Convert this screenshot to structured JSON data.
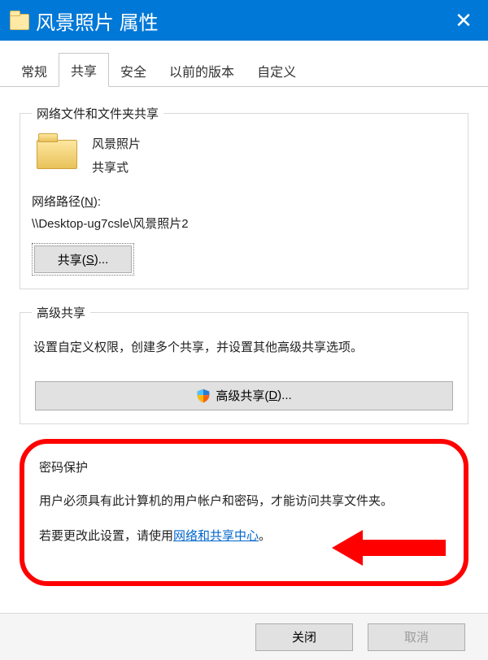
{
  "title": "风景照片 属性",
  "tabs": {
    "general": "常规",
    "sharing": "共享",
    "security": "安全",
    "previous_versions": "以前的版本",
    "customize": "自定义"
  },
  "active_tab": "sharing",
  "network_share": {
    "legend": "网络文件和文件夹共享",
    "folder_name": "风景照片",
    "folder_status": "共享式",
    "path_label_prefix": "网络路径(",
    "path_label_key": "N",
    "path_label_suffix": "):",
    "path_value": "\\\\Desktop-ug7csle\\风景照片2",
    "share_button_prefix": "共享(",
    "share_button_key": "S",
    "share_button_suffix": ")..."
  },
  "advanced_share": {
    "legend": "高级共享",
    "description": "设置自定义权限，创建多个共享，并设置其他高级共享选项。",
    "button_prefix": "高级共享(",
    "button_key": "D",
    "button_suffix": ")..."
  },
  "password": {
    "legend": "密码保护",
    "line1": "用户必须具有此计算机的用户帐户和密码，才能访问共享文件夹。",
    "line2_prefix": "若要更改此设置，请使用",
    "line2_link": "网络和共享中心",
    "line2_suffix": "。"
  },
  "footer": {
    "close": "关闭",
    "cancel": "取消"
  }
}
